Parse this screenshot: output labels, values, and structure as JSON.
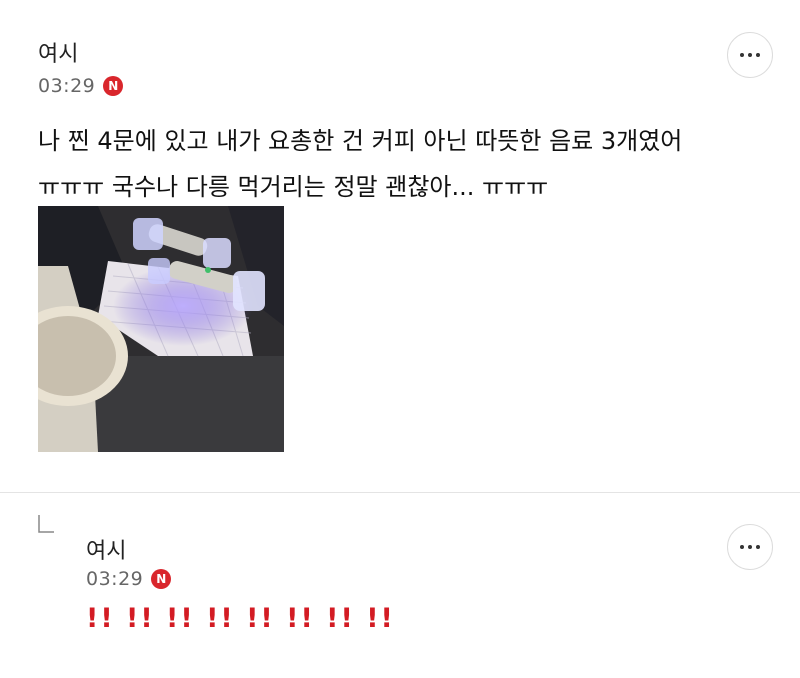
{
  "comments": [
    {
      "author": "여시",
      "time": "03:29",
      "badge": "N",
      "lines": [
        "나 찐 4문에 있고 내가 요총한 건 커피 아닌 따뜻한 음료 3개였어",
        "ㅠㅠㅠ 국수나 다릉 먹거리는 정말 괜찮아... ㅠㅠㅠ"
      ],
      "photo_icon": "photo-light-sticks-on-notebook"
    },
    {
      "author": "여시",
      "time": "03:29",
      "badge": "N",
      "text": "!! !! !! !! !! !! !! !!",
      "is_reply": true
    }
  ],
  "icons": {
    "more": "more-horizontal-icon",
    "reply": "reply-arrow-icon",
    "new": "new-badge-icon"
  },
  "colors": {
    "badge": "#d9262c",
    "reply_text": "#d31b23",
    "divider": "#e4e4e4"
  }
}
